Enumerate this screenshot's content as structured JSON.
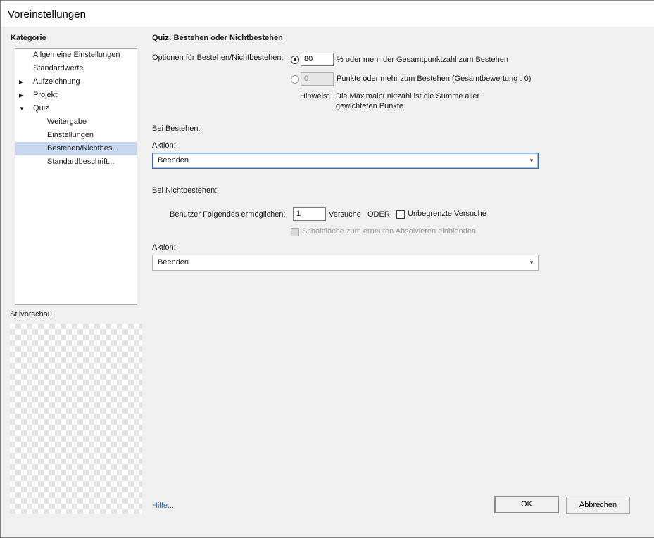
{
  "window": {
    "title": "Voreinstellungen"
  },
  "sidebar": {
    "heading": "Kategorie",
    "tree": [
      {
        "label": "Allgemeine Einstellungen",
        "level": 0,
        "arrow": ""
      },
      {
        "label": "Standardwerte",
        "level": 0,
        "arrow": ""
      },
      {
        "label": "Aufzeichnung",
        "level": 0,
        "arrow": "▶"
      },
      {
        "label": "Projekt",
        "level": 0,
        "arrow": "▶"
      },
      {
        "label": "Quiz",
        "level": 0,
        "arrow": "▼"
      },
      {
        "label": "Weitergabe",
        "level": 1,
        "arrow": ""
      },
      {
        "label": "Einstellungen",
        "level": 1,
        "arrow": ""
      },
      {
        "label": "Bestehen/Nichtbes...",
        "level": 1,
        "arrow": "",
        "selected": true
      },
      {
        "label": "Standardbeschrift...",
        "level": 1,
        "arrow": ""
      }
    ],
    "preview_label": "Stilvorschau"
  },
  "main": {
    "section_title": "Quiz: Bestehen oder Nichtbestehen",
    "options_label": "Optionen für Bestehen/Nichtbestehen:",
    "percent_option": {
      "value": "80",
      "suffix": "% oder mehr der Gesamtpunktzahl zum Bestehen",
      "selected": true
    },
    "points_option": {
      "value": "0",
      "suffix": "Punkte oder mehr zum Bestehen (Gesamtbewertung : 0)",
      "selected": false
    },
    "hint_label": "Hinweis:",
    "hint_line1": "Die Maximalpunktzahl ist die Summe aller",
    "hint_line2": "gewichteten Punkte.",
    "pass_heading": "Bei Bestehen:",
    "pass_action_label": "Aktion:",
    "pass_action_value": "Beenden",
    "fail_heading": "Bei Nichtbestehen:",
    "attempts_label": "Benutzer Folgendes ermöglichen:",
    "attempts_value": "1",
    "attempts_unit": "Versuche",
    "or_label": "ODER",
    "unlimited_label": "Unbegrenzte Versuche",
    "retake_label": "Schaltfläche zum erneuten Absolvieren einblenden",
    "fail_action_label": "Aktion:",
    "fail_action_value": "Beenden"
  },
  "footer": {
    "help_link": "Hilfe...",
    "ok_label": "OK",
    "cancel_label": "Abbrechen"
  },
  "colors": {
    "selection": "#c8d8f0",
    "link": "#2a6fba",
    "focus_border": "#3a6ea5"
  },
  "icons": {
    "collapsed": "triangle-right-icon",
    "expanded": "triangle-down-icon",
    "dropdown": "chevron-down-icon"
  }
}
